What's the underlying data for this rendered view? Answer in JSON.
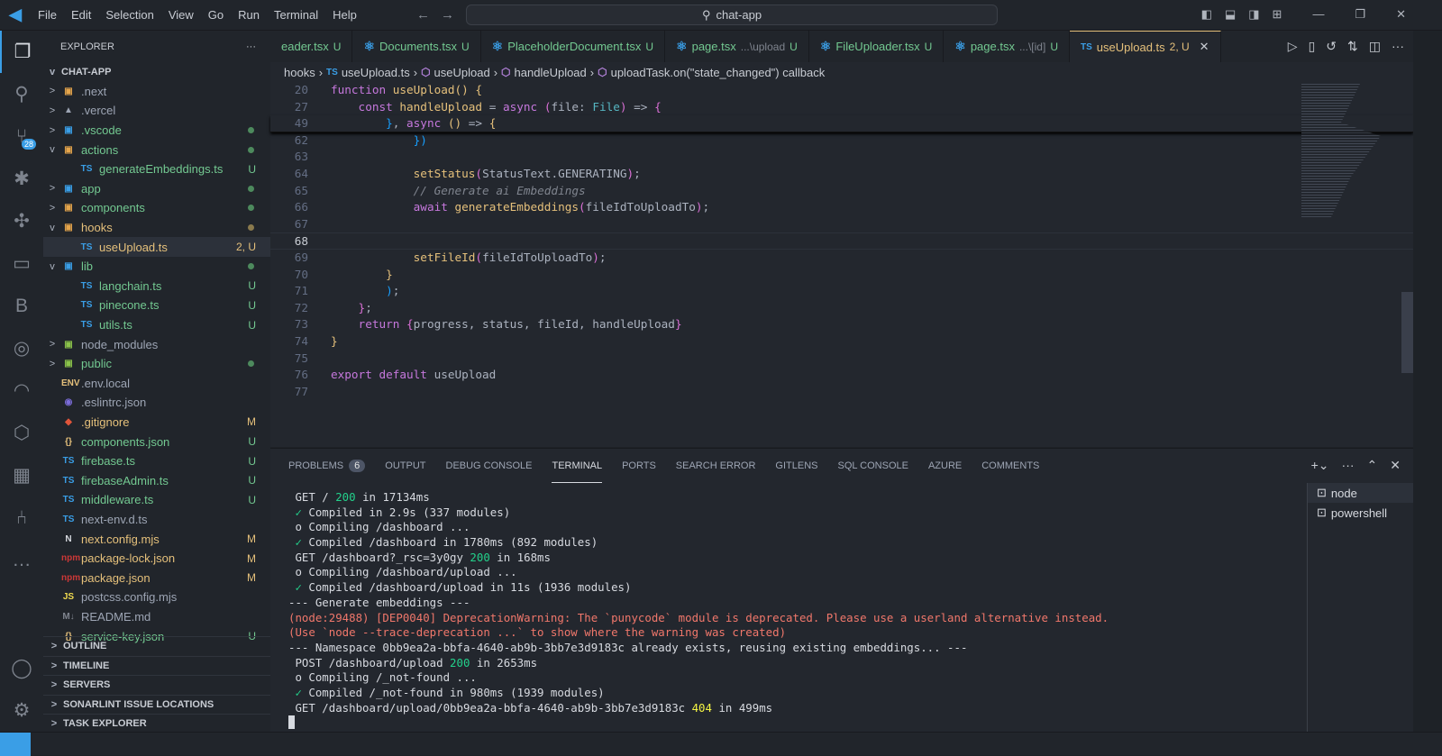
{
  "menu": [
    "File",
    "Edit",
    "Selection",
    "View",
    "Go",
    "Run",
    "Terminal",
    "Help"
  ],
  "search": {
    "value": "chat-app"
  },
  "activity": [
    {
      "icon": "files-icon",
      "glyph": "❐"
    },
    {
      "icon": "search-icon",
      "glyph": "⚲"
    },
    {
      "icon": "source-control-icon",
      "glyph": "⑂",
      "badge": "28"
    },
    {
      "icon": "debug-icon",
      "glyph": "✱"
    },
    {
      "icon": "extensions-icon",
      "glyph": "✣"
    },
    {
      "icon": "remote-explorer-icon",
      "glyph": "▭"
    },
    {
      "icon": "b-extension-icon",
      "glyph": "B"
    },
    {
      "icon": "testing-icon",
      "glyph": "◎"
    },
    {
      "icon": "wave-icon",
      "glyph": "◠"
    },
    {
      "icon": "cube-icon",
      "glyph": "⬡"
    },
    {
      "icon": "docker-icon",
      "glyph": "▦"
    },
    {
      "icon": "gitlens-icon",
      "glyph": "⑃"
    },
    {
      "icon": "more-icon",
      "glyph": "…"
    }
  ],
  "activity_bottom": [
    {
      "icon": "account-icon",
      "glyph": "◯"
    },
    {
      "icon": "settings-gear-icon",
      "glyph": "⚙"
    }
  ],
  "explorer": {
    "title": "EXPLORER",
    "root": "CHAT-APP",
    "items": [
      {
        "label": ".next",
        "indent": 1,
        "chev": ">",
        "icon": "▣",
        "iconColor": "#e5a54b",
        "color": "#9da5b4"
      },
      {
        "label": ".vercel",
        "indent": 1,
        "chev": ">",
        "icon": "▲",
        "iconColor": "#9da5b4",
        "color": "#9da5b4"
      },
      {
        "label": ".vscode",
        "indent": 1,
        "chev": ">",
        "icon": "▣",
        "iconColor": "#3a9ee6",
        "color": "#73c991",
        "dot": "#4d8a5d"
      },
      {
        "label": "actions",
        "indent": 1,
        "chev": "v",
        "icon": "▣",
        "iconColor": "#e5a54b",
        "color": "#73c991",
        "dot": "#4d8a5d"
      },
      {
        "label": "generateEmbeddings.ts",
        "indent": 2,
        "icon": "TS",
        "iconColor": "#3a9ee6",
        "color": "#73c991",
        "status": "U"
      },
      {
        "label": "app",
        "indent": 1,
        "chev": ">",
        "icon": "▣",
        "iconColor": "#3a9ee6",
        "color": "#73c991",
        "dot": "#4d8a5d"
      },
      {
        "label": "components",
        "indent": 1,
        "chev": ">",
        "icon": "▣",
        "iconColor": "#e5a54b",
        "color": "#73c991",
        "dot": "#4d8a5d"
      },
      {
        "label": "hooks",
        "indent": 1,
        "chev": "v",
        "icon": "▣",
        "iconColor": "#e5a54b",
        "color": "#e5c07b",
        "dot": "#8a7a4d"
      },
      {
        "label": "useUpload.ts",
        "indent": 2,
        "icon": "TS",
        "iconColor": "#3a9ee6",
        "color": "#e5c07b",
        "status": "2, U",
        "selected": true
      },
      {
        "label": "lib",
        "indent": 1,
        "chev": "v",
        "icon": "▣",
        "iconColor": "#3a9ee6",
        "color": "#73c991",
        "dot": "#4d8a5d"
      },
      {
        "label": "langchain.ts",
        "indent": 2,
        "icon": "TS",
        "iconColor": "#3a9ee6",
        "color": "#73c991",
        "status": "U"
      },
      {
        "label": "pinecone.ts",
        "indent": 2,
        "icon": "TS",
        "iconColor": "#3a9ee6",
        "color": "#73c991",
        "status": "U"
      },
      {
        "label": "utils.ts",
        "indent": 2,
        "icon": "TS",
        "iconColor": "#3a9ee6",
        "color": "#73c991",
        "status": "U"
      },
      {
        "label": "node_modules",
        "indent": 1,
        "chev": ">",
        "icon": "▣",
        "iconColor": "#8bc34a",
        "color": "#9da5b4"
      },
      {
        "label": "public",
        "indent": 1,
        "chev": ">",
        "icon": "▣",
        "iconColor": "#8bc34a",
        "color": "#73c991",
        "dot": "#4d8a5d"
      },
      {
        "label": ".env.local",
        "indent": 1,
        "icon": "ENV",
        "iconColor": "#e5c07b",
        "color": "#9da5b4"
      },
      {
        "label": ".eslintrc.json",
        "indent": 1,
        "icon": "◉",
        "iconColor": "#7b6cd9",
        "color": "#9da5b4"
      },
      {
        "label": ".gitignore",
        "indent": 1,
        "icon": "◆",
        "iconColor": "#e0553a",
        "color": "#e5c07b",
        "status": "M"
      },
      {
        "label": "components.json",
        "indent": 1,
        "icon": "{}",
        "iconColor": "#e5c07b",
        "color": "#73c991",
        "status": "U"
      },
      {
        "label": "firebase.ts",
        "indent": 1,
        "icon": "TS",
        "iconColor": "#3a9ee6",
        "color": "#73c991",
        "status": "U"
      },
      {
        "label": "firebaseAdmin.ts",
        "indent": 1,
        "icon": "TS",
        "iconColor": "#3a9ee6",
        "color": "#73c991",
        "status": "U"
      },
      {
        "label": "middleware.ts",
        "indent": 1,
        "icon": "TS",
        "iconColor": "#3a9ee6",
        "color": "#73c991",
        "status": "U"
      },
      {
        "label": "next-env.d.ts",
        "indent": 1,
        "icon": "TS",
        "iconColor": "#3a9ee6",
        "color": "#9da5b4"
      },
      {
        "label": "next.config.mjs",
        "indent": 1,
        "icon": "N",
        "iconColor": "#d7dae0",
        "color": "#e5c07b",
        "status": "M"
      },
      {
        "label": "package-lock.json",
        "indent": 1,
        "icon": "npm",
        "iconColor": "#cb3837",
        "color": "#e5c07b",
        "status": "M"
      },
      {
        "label": "package.json",
        "indent": 1,
        "icon": "npm",
        "iconColor": "#cb3837",
        "color": "#e5c07b",
        "status": "M"
      },
      {
        "label": "postcss.config.mjs",
        "indent": 1,
        "icon": "JS",
        "iconColor": "#f0db4f",
        "color": "#9da5b4"
      },
      {
        "label": "README.md",
        "indent": 1,
        "icon": "M↓",
        "iconColor": "#7f848e",
        "color": "#9da5b4"
      },
      {
        "label": "service-key.json",
        "indent": 1,
        "icon": "{}",
        "iconColor": "#e5c07b",
        "color": "#73c991",
        "status": "U"
      }
    ],
    "sections": [
      "OUTLINE",
      "TIMELINE",
      "SERVERS",
      "SONARLINT ISSUE LOCATIONS",
      "TASK EXPLORER"
    ]
  },
  "tabs": [
    {
      "label": "eader.tsx",
      "icon": "⚛",
      "status": "U",
      "color": "#73c991"
    },
    {
      "label": "Documents.tsx",
      "icon": "⚛",
      "status": "U",
      "color": "#73c991"
    },
    {
      "label": "PlaceholderDocument.tsx",
      "icon": "⚛",
      "status": "U",
      "color": "#73c991"
    },
    {
      "label": "page.tsx",
      "desc": "...\\upload",
      "icon": "⚛",
      "status": "U",
      "color": "#73c991"
    },
    {
      "label": "FileUploader.tsx",
      "icon": "⚛",
      "status": "U",
      "color": "#73c991"
    },
    {
      "label": "page.tsx",
      "desc": "...\\[id]",
      "icon": "⚛",
      "status": "U",
      "color": "#73c991"
    },
    {
      "label": "useUpload.ts",
      "icon": "TS",
      "status": "2, U",
      "color": "#e5c07b",
      "active": true
    }
  ],
  "breadcrumb": [
    "hooks",
    "useUpload.ts",
    "useUpload",
    "handleUpload",
    "uploadTask.on(\"state_changed\") callback"
  ],
  "code": [
    {
      "n": "20",
      "sticky": true,
      "t": [
        [
          "function ",
          "k"
        ],
        [
          "useUpload",
          "f"
        ],
        [
          "() ",
          "b1"
        ],
        [
          "{",
          "b1"
        ]
      ]
    },
    {
      "n": "27",
      "sticky": true,
      "t": [
        [
          "    const ",
          "k"
        ],
        [
          "handleUpload",
          "f"
        ],
        [
          " = ",
          "p"
        ],
        [
          "async ",
          "k"
        ],
        [
          "(",
          "b2"
        ],
        [
          "file",
          "p"
        ],
        [
          ": ",
          "p"
        ],
        [
          "File",
          "t"
        ],
        [
          ")",
          "b2"
        ],
        [
          " => ",
          "p"
        ],
        [
          "{",
          "b2"
        ]
      ]
    },
    {
      "n": "49",
      "sticky": true,
      "t": [
        [
          "        }",
          "b3"
        ],
        [
          ", ",
          "p"
        ],
        [
          "async ",
          "k"
        ],
        [
          "() ",
          "b1"
        ],
        [
          "=> ",
          "p"
        ],
        [
          "{",
          "b1"
        ]
      ]
    },
    {
      "n": "62",
      "t": [
        [
          "            })",
          "b3"
        ]
      ]
    },
    {
      "n": "63",
      "t": []
    },
    {
      "n": "64",
      "t": [
        [
          "            setStatus",
          "f"
        ],
        [
          "(",
          "b2"
        ],
        [
          "StatusText.GENERATING",
          "p"
        ],
        [
          ")",
          "b2"
        ],
        [
          ";",
          "p"
        ]
      ]
    },
    {
      "n": "65",
      "t": [
        [
          "            // Generate ai Embeddings",
          "c"
        ]
      ]
    },
    {
      "n": "66",
      "t": [
        [
          "            await ",
          "k"
        ],
        [
          "generateEmbeddings",
          "f"
        ],
        [
          "(",
          "b2"
        ],
        [
          "fileIdToUploadTo",
          "p"
        ],
        [
          ")",
          "b2"
        ],
        [
          ";",
          "p"
        ]
      ]
    },
    {
      "n": "67",
      "t": []
    },
    {
      "n": "68",
      "t": [],
      "current": true
    },
    {
      "n": "69",
      "t": [
        [
          "            setFileId",
          "f"
        ],
        [
          "(",
          "b2"
        ],
        [
          "fileIdToUploadTo",
          "p"
        ],
        [
          ")",
          "b2"
        ],
        [
          ";",
          "p"
        ]
      ]
    },
    {
      "n": "70",
      "t": [
        [
          "        }",
          "b1"
        ]
      ]
    },
    {
      "n": "71",
      "t": [
        [
          "        )",
          "b3"
        ],
        [
          ";",
          "p"
        ]
      ]
    },
    {
      "n": "72",
      "t": [
        [
          "    }",
          "b2"
        ],
        [
          ";",
          "p"
        ]
      ]
    },
    {
      "n": "73",
      "t": [
        [
          "    return ",
          "k"
        ],
        [
          "{",
          "b2"
        ],
        [
          "progress, status, fileId, handleUpload",
          "p"
        ],
        [
          "}",
          "b2"
        ]
      ]
    },
    {
      "n": "74",
      "t": [
        [
          "}",
          "b1"
        ]
      ]
    },
    {
      "n": "75",
      "t": []
    },
    {
      "n": "76",
      "t": [
        [
          "export default ",
          "k"
        ],
        [
          "useUpload",
          "p"
        ]
      ]
    },
    {
      "n": "77",
      "t": []
    }
  ],
  "panel": {
    "tabs": [
      {
        "label": "PROBLEMS",
        "count": "6"
      },
      {
        "label": "OUTPUT"
      },
      {
        "label": "DEBUG CONSOLE"
      },
      {
        "label": "TERMINAL",
        "active": true
      },
      {
        "label": "PORTS"
      },
      {
        "label": "SEARCH ERROR"
      },
      {
        "label": "GITLENS"
      },
      {
        "label": "SQL CONSOLE"
      },
      {
        "label": "AZURE"
      },
      {
        "label": "COMMENTS"
      }
    ],
    "terminals": [
      "node",
      "powershell"
    ]
  },
  "terminal": [
    [
      [
        " GET / ",
        ""
      ],
      [
        "200",
        "g"
      ],
      [
        " in 17134ms",
        ""
      ]
    ],
    [
      [
        " ✓",
        "ok"
      ],
      [
        " Compiled in 2.9s (337 modules)",
        ""
      ]
    ],
    [
      [
        " o Compiling /dashboard ...",
        ""
      ]
    ],
    [
      [
        " ✓",
        "ok"
      ],
      [
        " Compiled /dashboard in 1780ms (892 modules)",
        ""
      ]
    ],
    [
      [
        " GET /dashboard?_rsc=3y0gy ",
        ""
      ],
      [
        "200",
        "g"
      ],
      [
        " in 168ms",
        ""
      ]
    ],
    [
      [
        " o Compiling /dashboard/upload ...",
        ""
      ]
    ],
    [
      [
        " ✓",
        "ok"
      ],
      [
        " Compiled /dashboard/upload in 11s (1936 modules)",
        ""
      ]
    ],
    [
      [
        "--- Generate embeddings ---",
        ""
      ]
    ],
    [
      [
        "(node:29488) [DEP0040] DeprecationWarning: The `punycode` module is deprecated. Please use a userland alternative instead.",
        "r"
      ]
    ],
    [
      [
        "(Use `node --trace-deprecation ...` to show where the warning was created)",
        "r"
      ]
    ],
    [
      [
        "--- Namespace 0bb9ea2a-bbfa-4640-ab9b-3bb7e3d9183c already exists, reusing existing embeddings... ---",
        ""
      ]
    ],
    [
      [
        " POST /dashboard/upload ",
        ""
      ],
      [
        "200",
        "g"
      ],
      [
        " in 2653ms",
        ""
      ]
    ],
    [
      [
        " o Compiling /_not-found ...",
        ""
      ]
    ],
    [
      [
        " ✓",
        "ok"
      ],
      [
        " Compiled /_not-found in 980ms (1939 modules)",
        ""
      ]
    ],
    [
      [
        " GET /dashboard/upload/0bb9ea2a-bbfa-4640-ab9b-3bb7e3d9183c ",
        ""
      ],
      [
        "404",
        "y"
      ],
      [
        " in 499ms",
        ""
      ]
    ]
  ]
}
